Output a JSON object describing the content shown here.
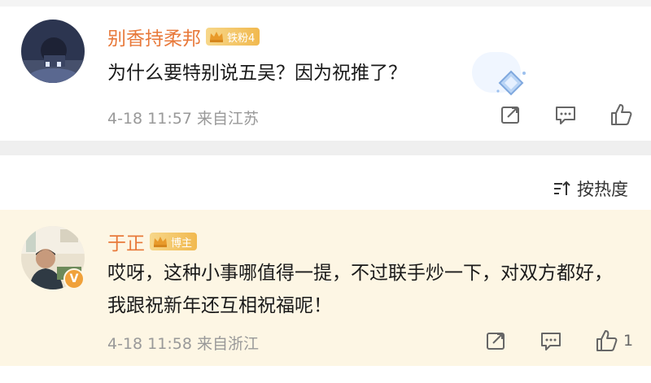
{
  "comments": [
    {
      "username": "别香持柔邦",
      "badge": "铁粉4",
      "text": "为什么要特别说五吴？因为祝推了？",
      "meta": "4-18 11:57 来自江苏",
      "like_count": ""
    },
    {
      "username": "于正",
      "badge": "博主",
      "text": "哎呀，这种小事哪值得一提，不过联手炒一下，对双方都好，我跟祝新年还互相祝福呢！",
      "meta": "4-18 11:58 来自浙江",
      "like_count": "1",
      "verified_mark": "V"
    }
  ],
  "sort": {
    "label": "按热度"
  },
  "colors": {
    "username": "#e8793a",
    "highlight_bg": "#fdf6e4",
    "meta": "#999999"
  }
}
